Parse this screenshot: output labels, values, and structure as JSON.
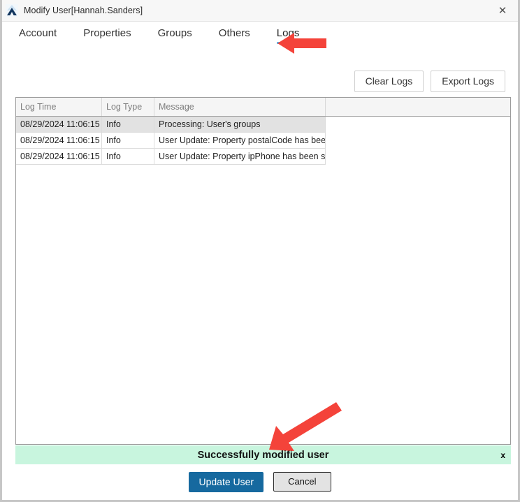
{
  "window": {
    "title": "Modify User[Hannah.Sanders]",
    "app_icon": "mountain-chevron-icon",
    "close_icon": "✕",
    "accent_blue": "#4fb3e8",
    "primary_blue": "#16699f",
    "success_green": "#c8f5de",
    "annotation_red": "#f4433a"
  },
  "tabs": [
    {
      "label": "Account",
      "active": false
    },
    {
      "label": "Properties",
      "active": false
    },
    {
      "label": "Groups",
      "active": false
    },
    {
      "label": "Others",
      "active": false
    },
    {
      "label": "Logs",
      "active": true
    }
  ],
  "toolbar": {
    "clear_logs_label": "Clear Logs",
    "export_logs_label": "Export Logs"
  },
  "logs_table": {
    "columns": [
      "Log Time",
      "Log Type",
      "Message",
      ""
    ],
    "rows": [
      {
        "time": "08/29/2024 11:06:15",
        "type": "Info",
        "message": "Processing: User's groups",
        "selected": true
      },
      {
        "time": "08/29/2024 11:06:15",
        "type": "Info",
        "message": "User Update: Property postalCode has been set",
        "selected": false
      },
      {
        "time": "08/29/2024 11:06:15",
        "type": "Info",
        "message": "User Update: Property ipPhone has been set",
        "selected": false
      }
    ]
  },
  "banner": {
    "message": "Successfully modified user",
    "close_label": "x"
  },
  "footer": {
    "update_label": "Update User",
    "cancel_label": "Cancel"
  }
}
